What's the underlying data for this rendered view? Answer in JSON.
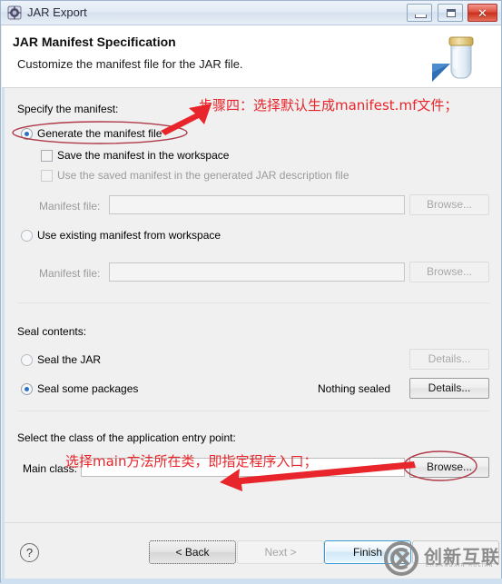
{
  "window": {
    "title": "JAR Export",
    "icon": "jar-export-icon",
    "controls": {
      "minimize": "minimize-icon",
      "maximize": "maximize-icon",
      "close": "✕"
    }
  },
  "header": {
    "title": "JAR Manifest Specification",
    "subtitle": "Customize the manifest file for the JAR file.",
    "art_icon": "jar-jar-illustration"
  },
  "manifest_section": {
    "group_label": "Specify the manifest:",
    "generate_radio": {
      "label": "Generate the manifest file",
      "selected": true
    },
    "save_checkbox": {
      "label": "Save the manifest in the workspace",
      "checked": false,
      "enabled": true
    },
    "use_saved_checkbox": {
      "label": "Use the saved manifest in the generated JAR description file",
      "checked": false,
      "enabled": false
    },
    "generate_manifest_file": {
      "label": "Manifest file:",
      "value": "",
      "browse": "Browse...",
      "enabled": false
    },
    "existing_radio": {
      "label": "Use existing manifest from workspace",
      "selected": false
    },
    "existing_manifest_file": {
      "label": "Manifest file:",
      "value": "",
      "browse": "Browse...",
      "enabled": false
    }
  },
  "seal_section": {
    "group_label": "Seal contents:",
    "seal_jar": {
      "label": "Seal the JAR",
      "selected": false,
      "details": "Details...",
      "details_enabled": false
    },
    "seal_packages": {
      "label": "Seal some packages",
      "selected": true,
      "status": "Nothing sealed",
      "details": "Details...",
      "details_enabled": true
    }
  },
  "entry_section": {
    "group_label": "Select the class of the application entry point:",
    "main_class_label": "Main class:",
    "main_class_value": "",
    "browse": "Browse..."
  },
  "footer": {
    "help": "?",
    "back": "< Back",
    "next": "Next >",
    "finish": "Finish",
    "cancel": ""
  },
  "annotations": {
    "step_four": "步骤四：选择默认生成manifest.mf文件；",
    "main_class_note": "选择main方法所在类，即指定程序入口；",
    "color": "#e8252a",
    "ellipse_color": "#b03a48"
  },
  "watermark": {
    "text": "创新互联",
    "subtext": "CHUANGXIN HULIAN",
    "logo": "cx-logo-icon"
  }
}
